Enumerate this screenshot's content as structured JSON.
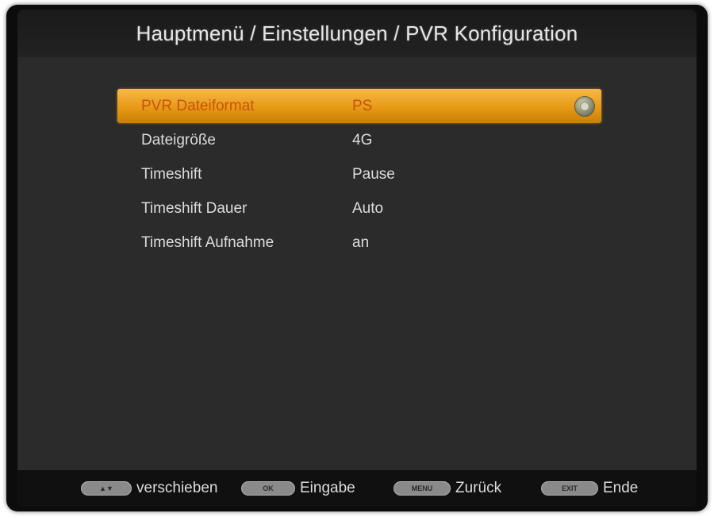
{
  "header": {
    "title": "Hauptmenü / Einstellungen / PVR Konfiguration"
  },
  "menu": {
    "items": [
      {
        "label": "PVR Dateiformat",
        "value": "PS",
        "selected": true
      },
      {
        "label": "Dateigröße",
        "value": "4G"
      },
      {
        "label": "Timeshift",
        "value": "Pause"
      },
      {
        "label": "Timeshift Dauer",
        "value": "Auto"
      },
      {
        "label": "Timeshift Aufnahme",
        "value": "an"
      }
    ]
  },
  "footer": {
    "hints": [
      {
        "key": "▲▼",
        "label": "verschieben"
      },
      {
        "key": "OK",
        "label": "Eingabe"
      },
      {
        "key": "MENU",
        "label": "Zurück"
      },
      {
        "key": "EXIT",
        "label": "Ende"
      }
    ]
  },
  "colors": {
    "highlight": "#e79a14",
    "background": "#2b2b2b",
    "text": "#dcdcdc"
  },
  "icons": {
    "select_icon": "ok-button-icon"
  }
}
